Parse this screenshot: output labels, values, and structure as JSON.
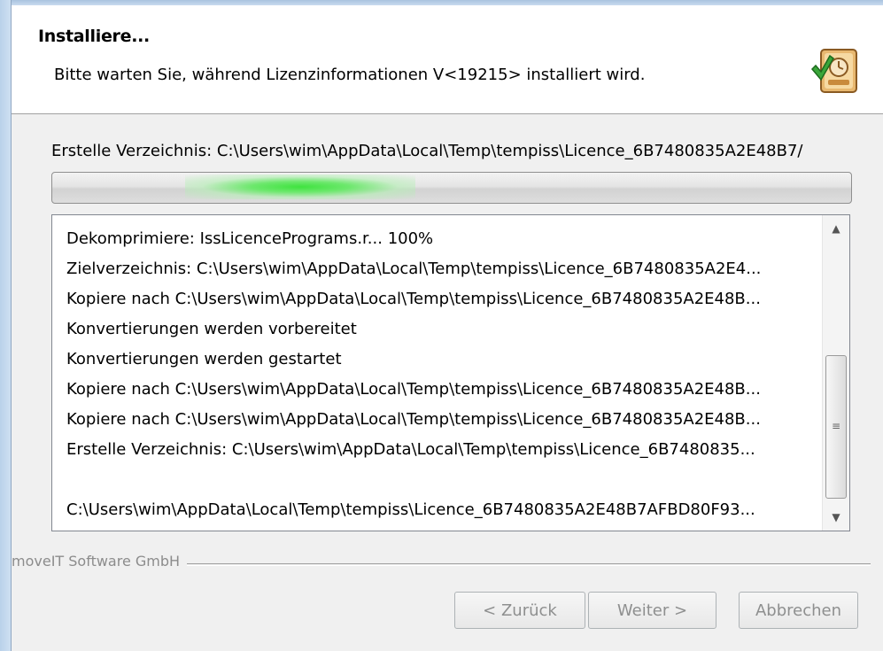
{
  "header": {
    "title": "Installiere...",
    "subtitle": "Bitte warten Sie, während Lizenzinformationen V<19215> installiert wird.",
    "icon": "installer-icon"
  },
  "status": {
    "text": "Erstelle Verzeichnis: C:\\Users\\wim\\AppData\\Local\\Temp\\tempiss\\Licence_6B7480835A2E48B7/"
  },
  "progress": {
    "mode": "indeterminate-marquee",
    "color": "#3fe33f"
  },
  "log": {
    "lines": [
      "Dekomprimiere: IssLicencePrograms.r... 100%",
      "Zielverzeichnis: C:\\Users\\wim\\AppData\\Local\\Temp\\tempiss\\Licence_6B7480835A2E4...",
      "Kopiere nach C:\\Users\\wim\\AppData\\Local\\Temp\\tempiss\\Licence_6B7480835A2E48B...",
      "Konvertierungen werden vorbereitet",
      "Konvertierungen werden gestartet",
      "Kopiere nach C:\\Users\\wim\\AppData\\Local\\Temp\\tempiss\\Licence_6B7480835A2E48B...",
      "Kopiere nach C:\\Users\\wim\\AppData\\Local\\Temp\\tempiss\\Licence_6B7480835A2E48B...",
      "Erstelle Verzeichnis: C:\\Users\\wim\\AppData\\Local\\Temp\\tempiss\\Licence_6B7480835...",
      "",
      "C:\\Users\\wim\\AppData\\Local\\Temp\\tempiss\\Licence_6B7480835A2E48B7AFBD80F93..."
    ]
  },
  "footer": {
    "brand": "moveIT Software GmbH",
    "back_label": "< Zurück",
    "next_label": "Weiter >",
    "cancel_label": "Abbrechen"
  }
}
